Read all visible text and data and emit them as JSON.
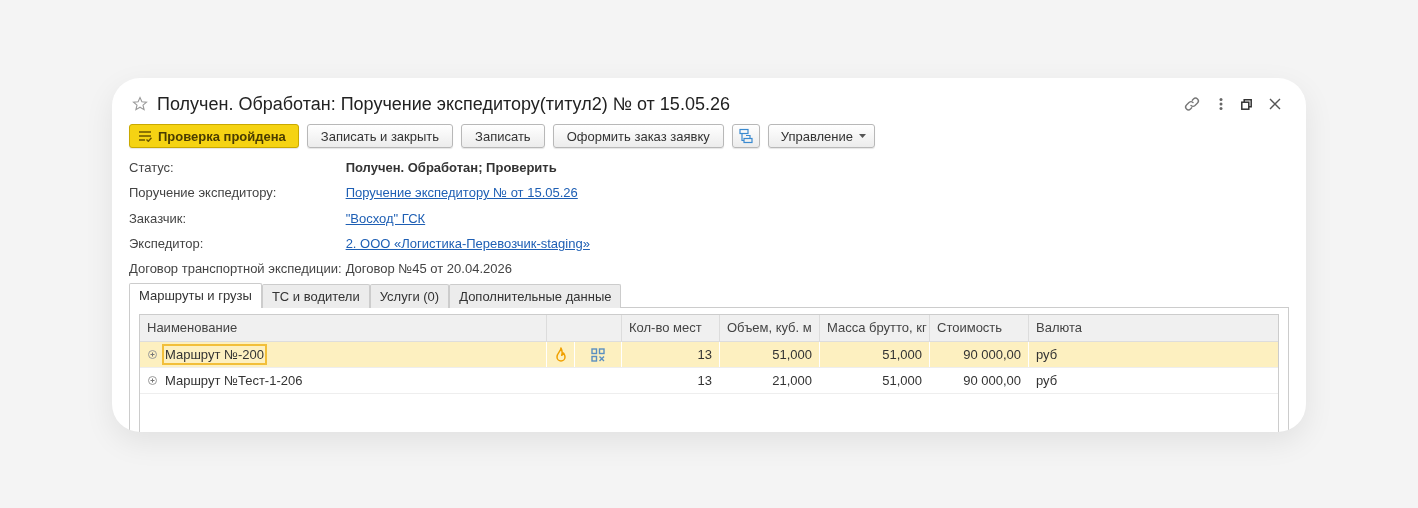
{
  "window": {
    "title": "Получен. Обработан: Поручение экспедитору(титул2) № от 15.05.26",
    "favorite": false
  },
  "toolbar": [
    {
      "kind": "primary",
      "label": "Проверка пройдена"
    },
    {
      "kind": "plain",
      "label": "Записать и закрыть"
    },
    {
      "kind": "plain",
      "label": "Записать"
    },
    {
      "kind": "plain",
      "label": "Оформить заказ заявку"
    },
    {
      "kind": "icon"
    },
    {
      "kind": "menu",
      "label": "Управление"
    }
  ],
  "fields": [
    {
      "label": "Статус:",
      "value": "Получен. Обработан; Проверить",
      "kind": "bold"
    },
    {
      "label": "Поручение экспедитору:",
      "value": "Поручение экспедитору № от 15.05.26",
      "kind": "link"
    },
    {
      "label": "Заказчик:",
      "value": "\"Восход\" ГСК",
      "kind": "link"
    },
    {
      "label": "Экспедитор:",
      "value": "2. ООО «Логистика-Перевозчик-staging»",
      "kind": "link"
    },
    {
      "label": "Договор транспортной экспедиции:",
      "value": "Договор №45 от 20.04.2026",
      "kind": "text"
    }
  ],
  "tabs": [
    {
      "label": "Маршруты и грузы",
      "selected": true
    },
    {
      "label": "ТС и водители",
      "selected": false
    },
    {
      "label": "Услуги (0)",
      "selected": false
    },
    {
      "label": "Дополнительные данные",
      "selected": false
    }
  ],
  "table": {
    "columns": [
      {
        "kind": "text",
        "label": "Наименование"
      },
      {
        "kind": "icons"
      },
      {
        "kind": "num",
        "label": "Кол-во мест"
      },
      {
        "kind": "num",
        "label": "Объем, куб. м"
      },
      {
        "kind": "num",
        "label": "Масса брутто, кг"
      },
      {
        "kind": "num",
        "label": "Стоимость"
      },
      {
        "kind": "text",
        "label": "Валюта"
      }
    ],
    "rows": [
      {
        "selected": true,
        "name": "Маршрут №-200",
        "hot": true,
        "qr": true,
        "places": "13",
        "volume": "51,000",
        "mass": "51,000",
        "cost": "90 000,00",
        "currency": "руб"
      },
      {
        "selected": false,
        "name": "Маршрут №Тест-1-206",
        "hot": false,
        "qr": false,
        "places": "13",
        "volume": "21,000",
        "mass": "51,000",
        "cost": "90 000,00",
        "currency": "руб"
      }
    ]
  }
}
